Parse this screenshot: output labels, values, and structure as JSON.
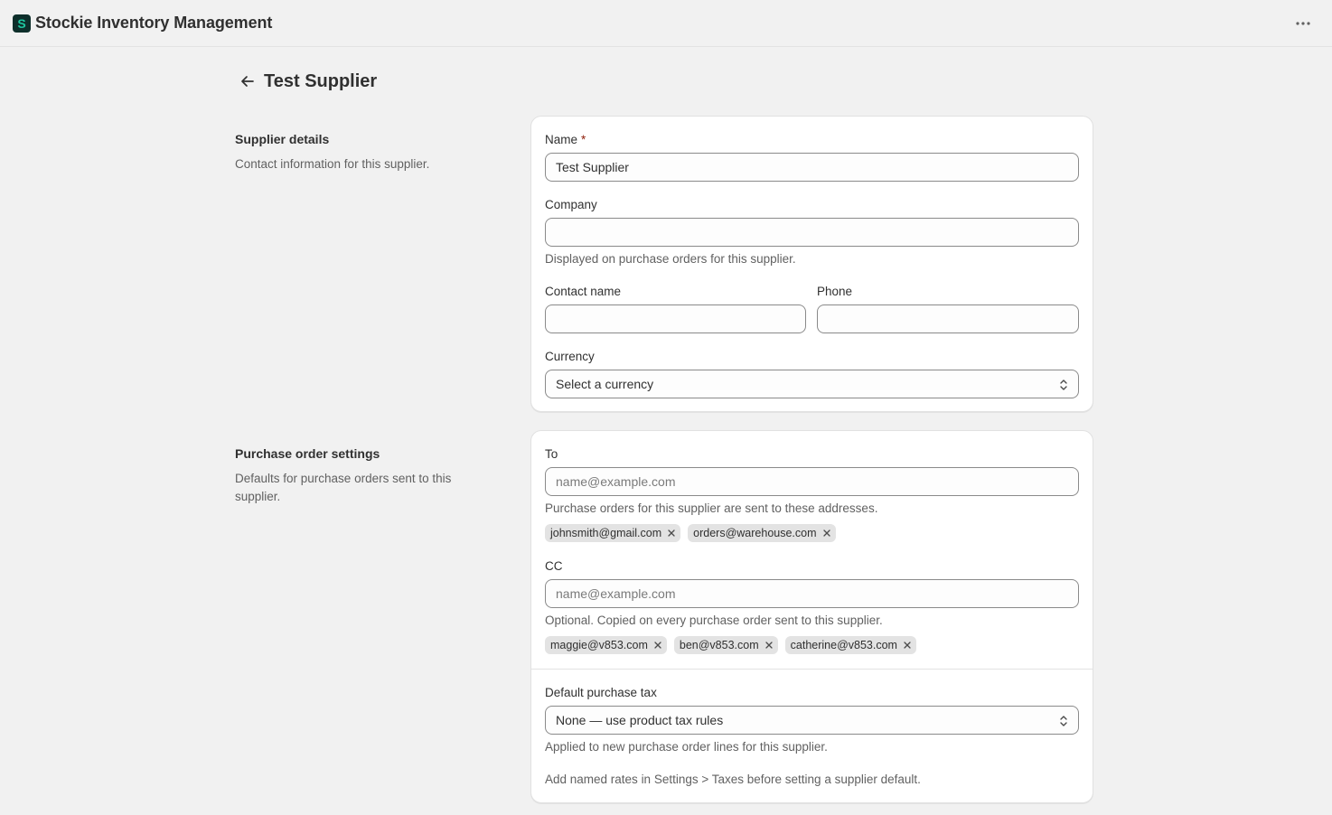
{
  "app": {
    "title": "Stockie Inventory Management",
    "logo_letter": "S",
    "logo_color": "#1ec7a0"
  },
  "page": {
    "title": "Test Supplier"
  },
  "supplier_details": {
    "title": "Supplier details",
    "description": "Contact information for this supplier.",
    "name_label": "Name",
    "required_mark": "*",
    "name_value": "Test Supplier",
    "company_label": "Company",
    "company_value": "",
    "company_help": "Displayed on purchase orders for this supplier.",
    "contact_label": "Contact name",
    "contact_value": "",
    "phone_label": "Phone",
    "phone_value": "",
    "currency_label": "Currency",
    "currency_value": "Select a currency"
  },
  "po_settings": {
    "title": "Purchase order settings",
    "description": "Defaults for purchase orders sent to this supplier.",
    "to_label": "To",
    "to_placeholder": "name@example.com",
    "to_help": "Purchase orders for this supplier are sent to these addresses.",
    "to_tags": [
      "johnsmith@gmail.com",
      "orders@warehouse.com"
    ],
    "cc_label": "CC",
    "cc_placeholder": "name@example.com",
    "cc_help": "Optional. Copied on every purchase order sent to this supplier.",
    "cc_tags": [
      "maggie@v853.com",
      "ben@v853.com",
      "catherine@v853.com"
    ],
    "tax_label": "Default purchase tax",
    "tax_value": "None — use product tax rules",
    "tax_help": "Applied to new purchase order lines for this supplier.",
    "tax_note": "Add named rates in Settings > Taxes before setting a supplier default."
  }
}
